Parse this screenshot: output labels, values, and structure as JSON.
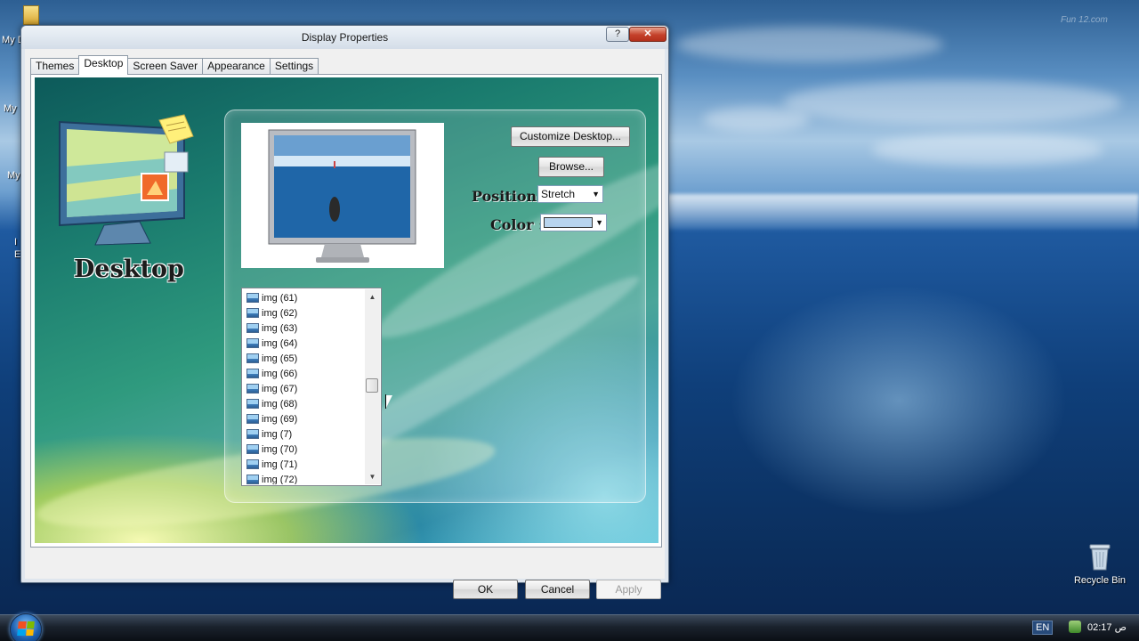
{
  "window": {
    "title": "Display Properties",
    "help_btn": "?",
    "close_btn": "✕"
  },
  "tabs": [
    {
      "label": "Themes"
    },
    {
      "label": "Desktop"
    },
    {
      "label": "Screen Saver"
    },
    {
      "label": "Appearance"
    },
    {
      "label": "Settings"
    }
  ],
  "desktop_panel": {
    "heading": "Desktop",
    "customize_label": "Customize Desktop...",
    "browse_label": "Browse...",
    "position_label": "Position :",
    "position_value": "Stretch",
    "color_label": "Color :",
    "color_value": "#b8d4ee",
    "list_items": [
      "img (61)",
      "img (62)",
      "img (63)",
      "img (64)",
      "img (65)",
      "img (66)",
      "img (67)",
      "img (68)",
      "img (69)",
      "img (7)",
      "img (70)",
      "img (71)",
      "img (72)"
    ],
    "list_scroll_fraction": 0.49
  },
  "buttons": {
    "ok": "OK",
    "cancel": "Cancel",
    "apply": "Apply"
  },
  "desktop": {
    "recycle_bin": "Recycle Bin",
    "watermark": "Fun 12.com",
    "icon_fragments": [
      "My D",
      "My",
      "My",
      "I",
      "E"
    ]
  },
  "taskbar": {
    "language": "EN",
    "clock": "02:17 ص"
  }
}
